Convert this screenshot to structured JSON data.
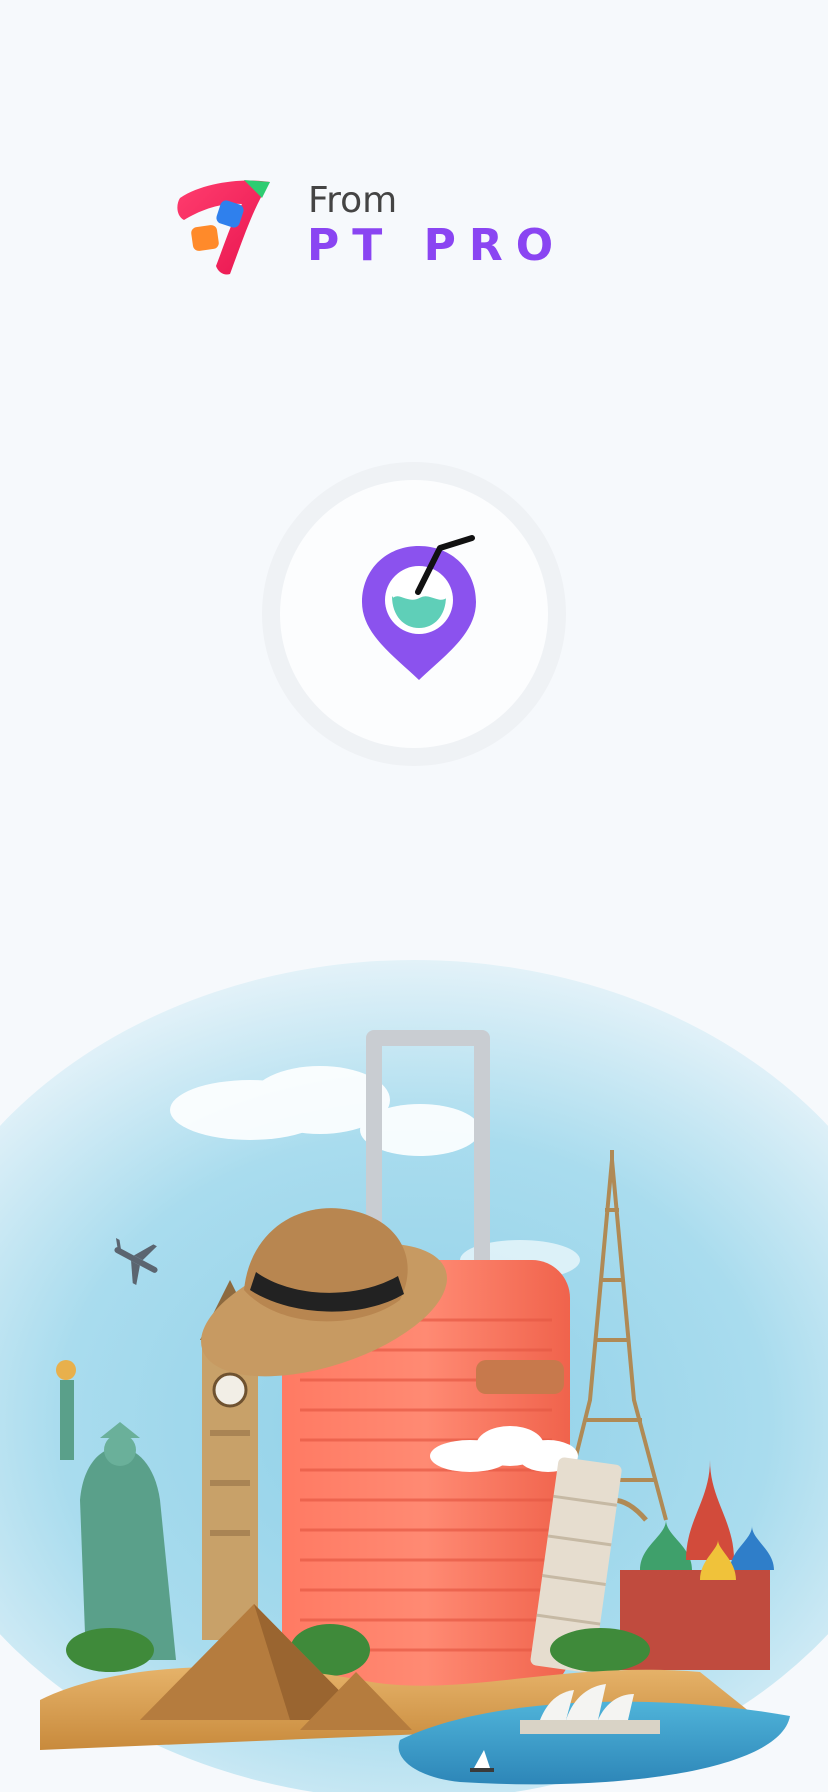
{
  "splash": {
    "from_label": "From",
    "company_name": "PT PRO",
    "brand_color": "#8a45f2",
    "background_color": "#f6f9fc"
  },
  "app_icon": {
    "name": "coconut-drink-location-pin-icon",
    "pin_color": "#8b52ee",
    "drink_color": "#5fcfb8"
  },
  "hero": {
    "name": "travel-landmarks-suitcase-illustration",
    "elements": [
      "suitcase",
      "straw-hat",
      "statue-of-liberty",
      "big-ben",
      "pyramids",
      "eiffel-tower",
      "leaning-tower-of-pisa",
      "st-basils-cathedral",
      "sydney-opera-house",
      "airplane",
      "clouds"
    ]
  }
}
